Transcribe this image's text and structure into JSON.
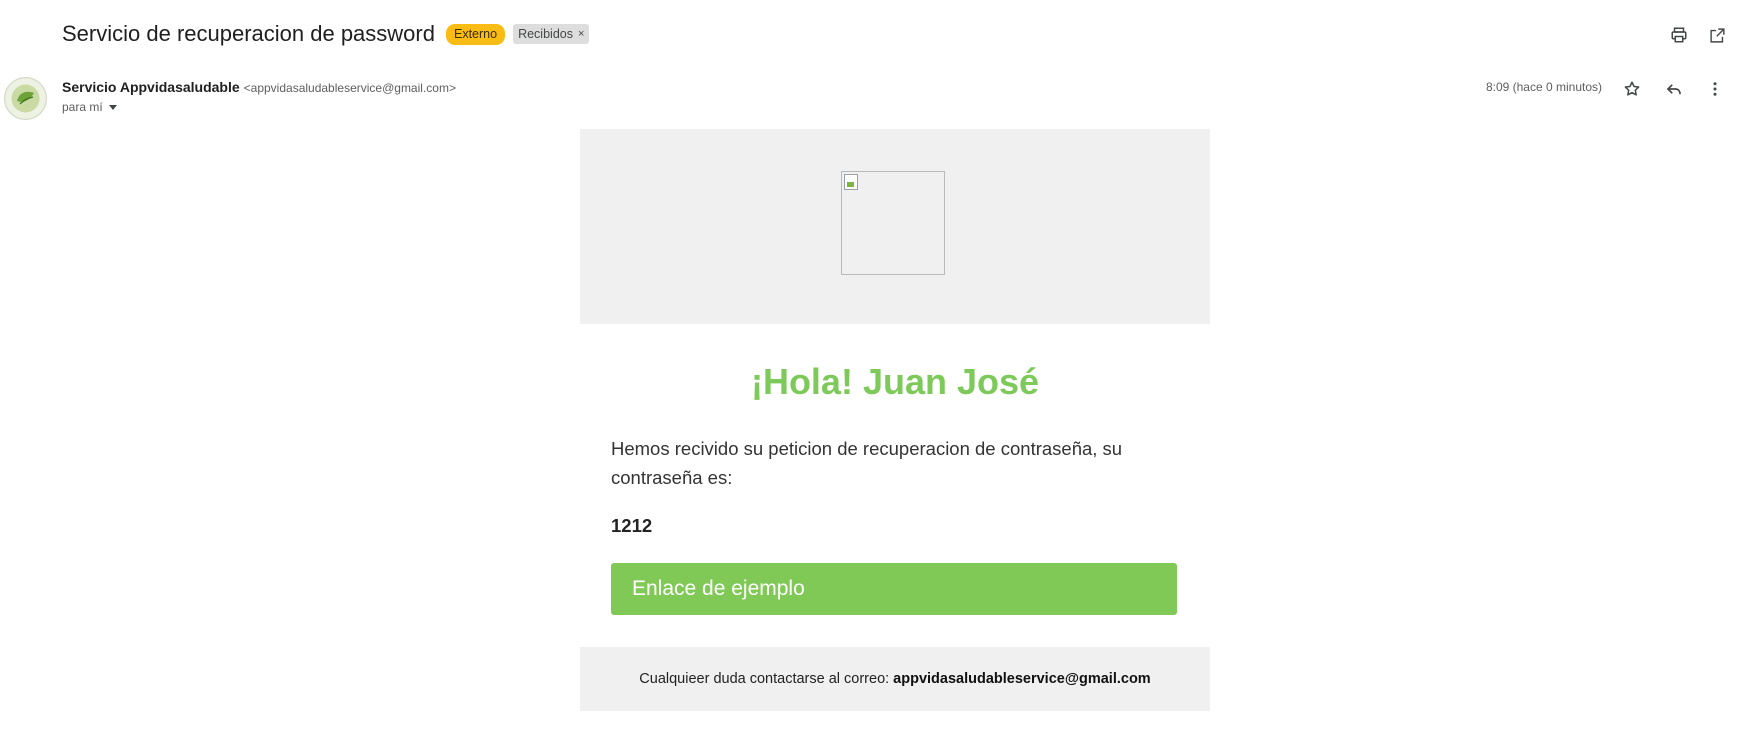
{
  "subject": "Servicio de recuperacion de password",
  "labels": {
    "externo": "Externo",
    "recibidos": "Recibidos",
    "remove_glyph": "×"
  },
  "toolbar": {
    "print_icon": "print-icon",
    "open_new_window_icon": "open-in-new-window-icon"
  },
  "message": {
    "sender_name": "Servicio Appvidasaludable",
    "sender_email": "<appvidasaludableservice@gmail.com>",
    "recipient": "para mí",
    "timestamp": "8:09 (hace 0 minutos)",
    "icons": [
      "star-icon",
      "reply-icon",
      "more-vert-icon"
    ]
  },
  "email_body": {
    "greeting": "¡Hola! Juan José",
    "text": "Hemos recivido su peticion de recuperacion de contraseña, su contraseña es:",
    "password": "1212",
    "button_label": "Enlace de ejemplo",
    "footer_text": "Cualquieer duda contactarse al correo:",
    "footer_email": "appvidasaludableservice@gmail.com"
  },
  "colors": {
    "accent_green": "#81c956",
    "greeting_green": "#7dc95a",
    "externo_label": "#f9bc15",
    "band_gray": "#f0f0f0"
  }
}
